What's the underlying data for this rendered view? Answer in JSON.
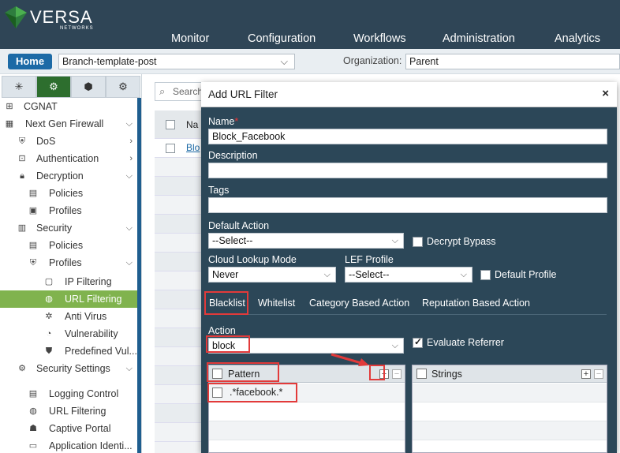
{
  "brand": {
    "name": "VERSA",
    "sub": "NETWORKS"
  },
  "nav": [
    "Monitor",
    "Configuration",
    "Workflows",
    "Administration",
    "Analytics"
  ],
  "subbar": {
    "home": "Home",
    "template": "Branch-template-post",
    "org_label": "Organization:",
    "org_value": "Parent"
  },
  "sidebar": {
    "tabs": [
      "network-icon",
      "gear-icon",
      "cube-icon",
      "settings-icon"
    ],
    "items": [
      {
        "label": "CGNAT",
        "icon": "nat-icon"
      },
      {
        "label": "Next Gen Firewall",
        "icon": "firewall-icon"
      },
      {
        "label": "DoS",
        "icon": "dos-icon"
      },
      {
        "label": "Authentication",
        "icon": "auth-icon"
      },
      {
        "label": "Decryption",
        "icon": "lock-icon"
      },
      {
        "label": "Policies",
        "icon": "policy-icon"
      },
      {
        "label": "Profiles",
        "icon": "profile-icon"
      },
      {
        "label": "Security",
        "icon": "wall-icon"
      },
      {
        "label": "Policies",
        "icon": "policy-icon"
      },
      {
        "label": "Profiles",
        "icon": "shield-icon"
      },
      {
        "label": "IP Filtering",
        "icon": "ip-filter-icon"
      },
      {
        "label": "URL Filtering",
        "icon": "globe-icon"
      },
      {
        "label": "Anti Virus",
        "icon": "virus-icon"
      },
      {
        "label": "Vulnerability",
        "icon": "vulnerability-icon"
      },
      {
        "label": "Predefined Vul...",
        "icon": "shield-icon"
      },
      {
        "label": "Security Settings",
        "icon": "settings-icon"
      },
      {
        "label": "Logging Control",
        "icon": "log-icon"
      },
      {
        "label": "URL Filtering",
        "icon": "globe-icon"
      },
      {
        "label": "Captive Portal",
        "icon": "portal-icon"
      },
      {
        "label": "Application Identi...",
        "icon": "app-icon"
      }
    ]
  },
  "background": {
    "search_placeholder": "Search",
    "col_header": "Na",
    "row_text": "Blo"
  },
  "modal": {
    "title": "Add URL Filter",
    "close": "×",
    "name_label": "Name",
    "name_req": "*",
    "name_value": "Block_Facebook",
    "description_label": "Description",
    "description_value": "",
    "tags_label": "Tags",
    "tags_value": "",
    "default_action_label": "Default Action",
    "default_action_value": "--Select--",
    "decrypt_bypass_label": "Decrypt Bypass",
    "cloud_lookup_label": "Cloud Lookup Mode",
    "cloud_lookup_value": "Never",
    "lef_profile_label": "LEF Profile",
    "lef_profile_value": "--Select--",
    "default_profile_label": "Default Profile",
    "tabs": [
      "Blacklist",
      "Whitelist",
      "Category Based Action",
      "Reputation Based Action"
    ],
    "action_label": "Action",
    "action_value": "block",
    "evaluate_referrer_label": "Evaluate Referrer",
    "pattern_header": "Pattern",
    "pattern_rows": [
      ".*facebook.*"
    ],
    "strings_header": "Strings",
    "plus": "+",
    "minus": "−"
  },
  "colors": {
    "topbar": "#2f4556",
    "modal": "#2c4758",
    "highlight": "#e23a3a",
    "selected": "#80b34e"
  }
}
